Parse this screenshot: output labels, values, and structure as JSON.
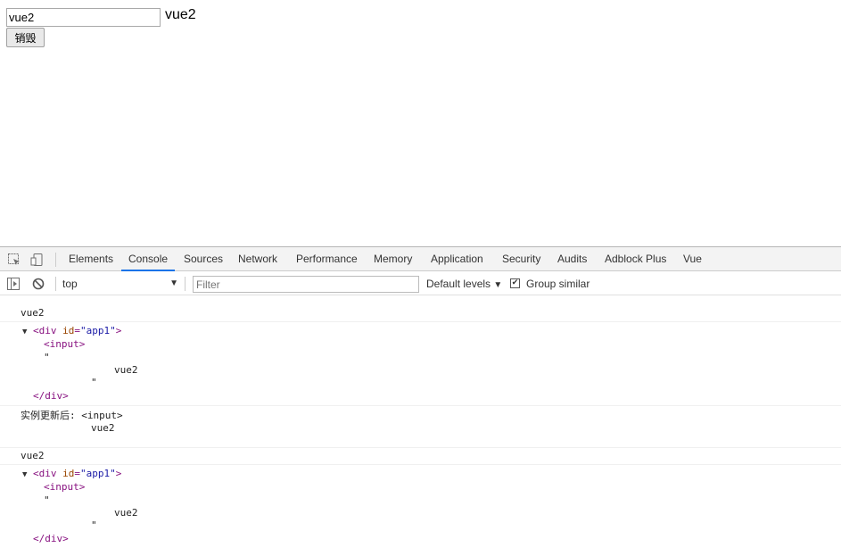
{
  "page": {
    "input_value": "vue2",
    "echo_text": "vue2",
    "destroy_label": "销毁"
  },
  "devtools": {
    "tabs": [
      {
        "label": "Elements",
        "active": false
      },
      {
        "label": "Console",
        "active": true
      },
      {
        "label": "Sources",
        "active": false
      },
      {
        "label": "Network",
        "active": false
      },
      {
        "label": "Performance",
        "active": false
      },
      {
        "label": "Memory",
        "active": false
      },
      {
        "label": "Application",
        "active": false
      },
      {
        "label": "Security",
        "active": false
      },
      {
        "label": "Audits",
        "active": false
      },
      {
        "label": "Adblock Plus",
        "active": false
      },
      {
        "label": "Vue",
        "active": false
      }
    ],
    "icons": [
      "inspect-icon",
      "device-toolbar-icon",
      "sidebar-toggle-icon",
      "clear-console-icon"
    ],
    "context": "top",
    "filter_placeholder": "Filter",
    "levels_label": "Default levels",
    "group_similar_label": "Group similar",
    "group_similar_checked": true,
    "accent_color": "#1a73e8"
  },
  "console": {
    "messages": [
      {
        "text": "vue2",
        "tree": {
          "open_tag": "<div id=\"app1\">",
          "tag_name": "div",
          "attr_name": "id",
          "attr_value": "\"app1\"",
          "child_tag": "<input>",
          "quote_open": "\"",
          "text_content": "vue2",
          "quote_close": "\"",
          "close_tag": "</div>"
        }
      },
      {
        "prefix": "实例更新后:",
        "tag": "<input>",
        "text": "vue2"
      },
      {
        "text": "vue2",
        "tree": {
          "open_tag": "<div id=\"app1\">",
          "tag_name": "div",
          "attr_name": "id",
          "attr_value": "\"app1\"",
          "child_tag": "<input>",
          "quote_open": "\"",
          "text_content": "vue2",
          "quote_close": "\"",
          "close_tag": "</div>"
        }
      }
    ]
  }
}
